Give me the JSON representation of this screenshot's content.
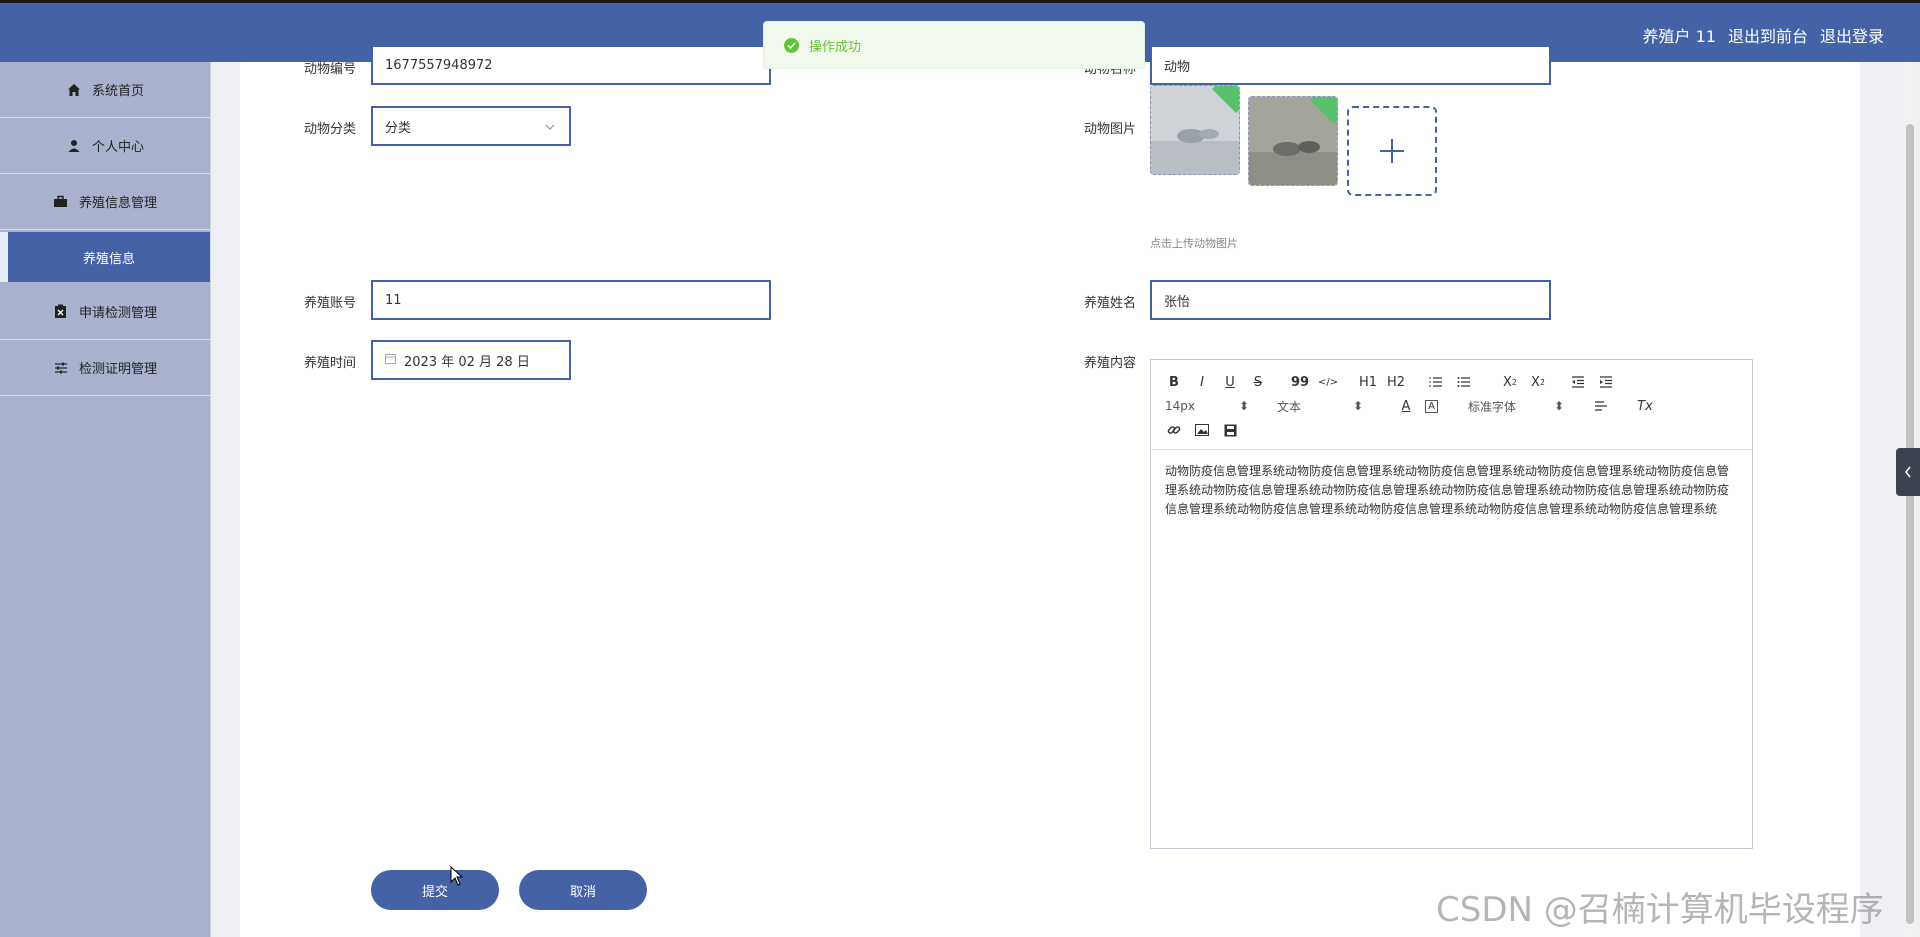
{
  "header": {
    "user": "养殖户 11",
    "to_front": "退出到前台",
    "logout": "退出登录",
    "bg_color": "#4363a6"
  },
  "sidebar": {
    "items": [
      {
        "label": "系统首页",
        "icon": "home-icon"
      },
      {
        "label": "个人中心",
        "icon": "user-icon"
      },
      {
        "label": "养殖信息管理",
        "icon": "briefcase-icon"
      },
      {
        "label": "养殖信息",
        "icon": ""
      },
      {
        "label": "申请检测管理",
        "icon": "clipboard-icon"
      },
      {
        "label": "检测证明管理",
        "icon": "sliders-icon"
      }
    ]
  },
  "toast": {
    "message": "操作成功",
    "color": "#67c23a"
  },
  "form": {
    "animal_no_label": "动物编号",
    "animal_no_value": "1677557948972",
    "animal_name_label": "动物名称",
    "animal_name_value": "动物",
    "category_label": "动物分类",
    "category_value": "分类",
    "image_label": "动物图片",
    "image_hint": "点击上传动物图片",
    "account_label": "养殖账号",
    "account_value": "11",
    "name_label": "养殖姓名",
    "name_value": "张怡",
    "time_label": "养殖时间",
    "time_value": "2023 年 02 月 28 日",
    "content_label": "养殖内容",
    "content_text": "动物防疫信息管理系统动物防疫信息管理系统动物防疫信息管理系统动物防疫信息管理系统动物防疫信息管理系统动物防疫信息管理系统动物防疫信息管理系统动物防疫信息管理系统动物防疫信息管理系统动物防疫信息管理系统动物防疫信息管理系统动物防疫信息管理系统动物防疫信息管理系统动物防疫信息管理系统",
    "submit": "提交",
    "cancel": "取消"
  },
  "editor_toolbar": {
    "font_size": "14px",
    "block_type": "文本",
    "font_family": "标准字体",
    "sub_x": "X",
    "sub_2": "2",
    "h1": "H1",
    "h2": "H2",
    "bold": "B",
    "italic": "I",
    "underline": "U",
    "strike": "S",
    "quote": "99",
    "code": "</>",
    "text_color": "A",
    "bg_color": "A",
    "clear": "Tx"
  },
  "watermark": "CSDN @召楠计算机毕设程序"
}
